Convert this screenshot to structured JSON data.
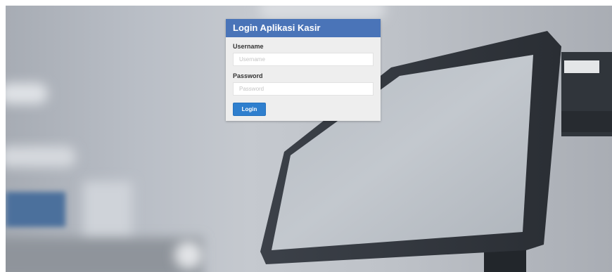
{
  "login": {
    "title": "Login Aplikasi Kasir",
    "username_label": "Username",
    "username_placeholder": "Username",
    "username_value": "",
    "password_label": "Password",
    "password_placeholder": "Password",
    "password_value": "",
    "button_label": "Login"
  },
  "colors": {
    "header_bg": "#4a74b8",
    "button_bg": "#2f7fce",
    "panel_bg": "#eeeeee"
  }
}
